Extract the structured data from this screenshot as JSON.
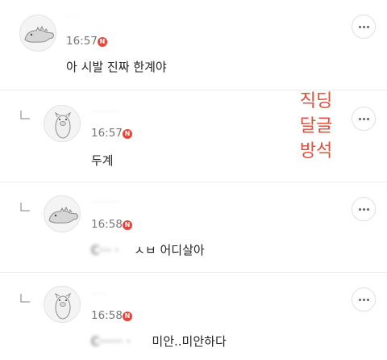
{
  "comments": [
    {
      "username": "·  ·",
      "time": "16:57",
      "badge": "N",
      "text": "아 시발 진짜 한계야",
      "text_blurred": "",
      "is_reply": false
    },
    {
      "username": "·········",
      "time": "16:57",
      "badge": "N",
      "text": "두계",
      "text_blurred": "",
      "is_reply": true
    },
    {
      "username": "·········",
      "time": "16:58",
      "badge": "N",
      "text": "ㅅㅂ 어디살아",
      "text_blurred": "C···  ·",
      "is_reply": true
    },
    {
      "username": "·····",
      "time": "16:58",
      "badge": "N",
      "text": "미안..미안하다",
      "text_blurred": "C······ ·",
      "is_reply": true
    }
  ],
  "overlay_text": {
    "line1": "직딩",
    "line2": "달글",
    "line3": "방석"
  },
  "colors": {
    "badge": "#e8443a",
    "overlay": "#e0503f",
    "divider": "#ececec"
  },
  "icons": {
    "more": "more-horizontal-icon",
    "reply": "reply-arrow-icon",
    "avatar_dino": "dinosaur-avatar",
    "avatar_pig": "pig-avatar"
  }
}
